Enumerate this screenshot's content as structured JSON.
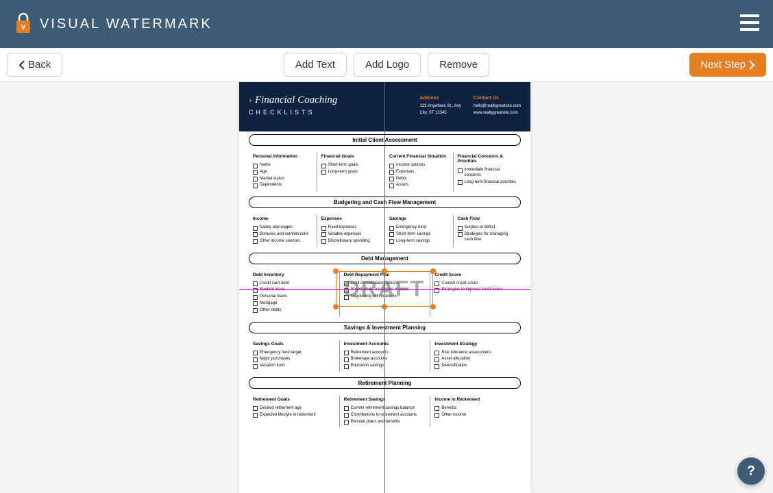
{
  "app": {
    "name": "VISUAL WATERMARK"
  },
  "toolbar": {
    "back": "Back",
    "add_text": "Add Text",
    "add_logo": "Add Logo",
    "remove": "Remove",
    "next_step": "Next Step"
  },
  "watermark": {
    "text": "DRAFT"
  },
  "document": {
    "title": "Financial Coaching",
    "subtitle": "CHECKLISTS",
    "address_label": "Address",
    "address_line1": "123 Anywhere St., Any",
    "address_line2": "City, ST 12345",
    "contact_label": "Contact Us",
    "contact_line1": "hello@reallygreatsite.com",
    "contact_line2": "www.reallygreatsite.com",
    "sections": [
      {
        "title": "Initial Client Assessment",
        "cols": [
          {
            "title": "Personal Information",
            "items": [
              "Name",
              "Age",
              "Marital status",
              "Dependents"
            ]
          },
          {
            "title": "Financial Goals",
            "items": [
              "Short-term goals",
              "Long-term goals"
            ]
          },
          {
            "title": "Current Financial Situation",
            "items": [
              "Income sources",
              "Expenses",
              "Debts",
              "Assets"
            ]
          },
          {
            "title": "Financial Concerns & Priorities",
            "items": [
              "Immediate financial concerns",
              "Long-term financial priorities"
            ]
          }
        ]
      },
      {
        "title": "Budgeting and Cash Flow Management",
        "cols": [
          {
            "title": "Income",
            "items": [
              "Salary and wages",
              "Bonuses and commissions",
              "Other income sources"
            ]
          },
          {
            "title": "Expenses",
            "items": [
              "Fixed expenses",
              "Variable expenses",
              "Discretionary spending"
            ]
          },
          {
            "title": "Savings",
            "items": [
              "Emergency fund",
              "Short-term savings",
              "Long-term savings"
            ]
          },
          {
            "title": "Cash Flow",
            "items": [
              "Surplus or deficit",
              "Strategies for managing cash flow"
            ]
          }
        ]
      },
      {
        "title": "Debt Management",
        "cols": [
          {
            "title": "Debt Inventory",
            "items": [
              "Credit card debt",
              "Student loans",
              "Personal loans",
              "Mortgage",
              "Other debts"
            ]
          },
          {
            "title": "Debt Repayment Plan",
            "items": [
              "Debt consolidation options",
              "Snowball vs. avalanche method",
              "Negotiating with creditors"
            ]
          },
          {
            "title": "Credit Score",
            "items": [
              "Current credit score",
              "Strategies to improve credit score"
            ]
          }
        ]
      },
      {
        "title": "Savings & Investment Planning",
        "cols": [
          {
            "title": "Savings Goals",
            "items": [
              "Emergency fund target",
              "Major purchases",
              "Vacation fund"
            ]
          },
          {
            "title": "Investment Accounts",
            "items": [
              "Retirement accounts",
              "Brokerage accounts",
              "Education savings"
            ]
          },
          {
            "title": "Investment Strategy",
            "items": [
              "Risk tolerance assessment",
              "Asset allocation",
              "Diversification"
            ]
          }
        ]
      },
      {
        "title": "Retirement Planning",
        "cols": [
          {
            "title": "Retirement Goals",
            "items": [
              "Desired retirement age",
              "Expected lifestyle in retirement"
            ]
          },
          {
            "title": "Retirement Savings",
            "items": [
              "Current retirement savings balance",
              "Contributions to retirement accounts",
              "Pension plans and benefits"
            ]
          },
          {
            "title": "Income in Retirement",
            "items": [
              "Benefits",
              "Other income"
            ]
          }
        ]
      }
    ]
  },
  "help": "?"
}
